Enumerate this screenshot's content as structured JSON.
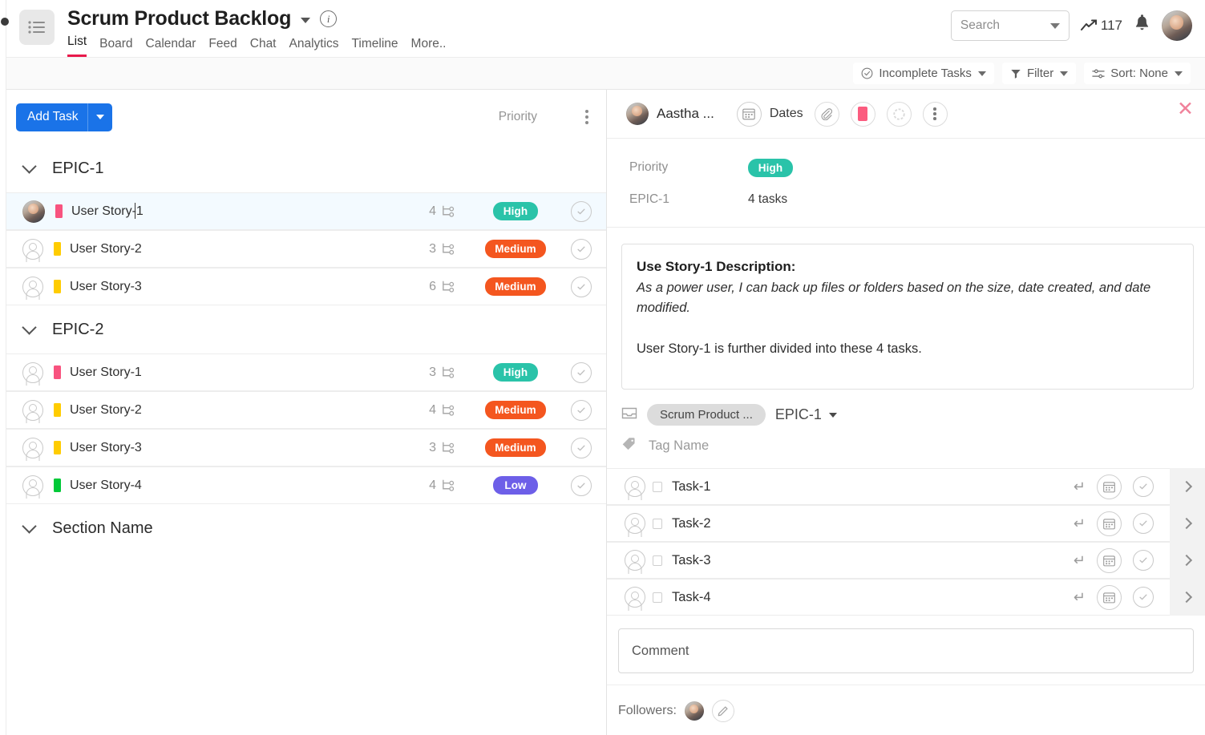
{
  "header": {
    "menu_icon": "hamburger-menu-icon",
    "project_title": "Scrum Product Backlog",
    "project_caret_icon": "chevron-down-icon",
    "info_icon": "info-icon",
    "info_glyph": "i",
    "tabs": [
      {
        "label": "List",
        "active": true
      },
      {
        "label": "Board",
        "active": false
      },
      {
        "label": "Calendar",
        "active": false
      },
      {
        "label": "Feed",
        "active": false
      },
      {
        "label": "Chat",
        "active": false
      },
      {
        "label": "Analytics",
        "active": false
      },
      {
        "label": "Timeline",
        "active": false
      },
      {
        "label": "More..",
        "active": false
      }
    ],
    "search": {
      "placeholder": "Search",
      "value": "",
      "caret_icon": "chevron-down-icon"
    },
    "stat": {
      "icon": "trend-line-icon",
      "count": "117"
    },
    "notification_icon": "bell-icon",
    "avatar": "user-avatar"
  },
  "toolbar": {
    "buttons": [
      {
        "label": "Incomplete Tasks",
        "icon": "check-circle-icon",
        "caret": true
      },
      {
        "label": "Filter",
        "icon": "funnel-icon",
        "caret": true
      },
      {
        "label": "Sort: None",
        "icon": "sliders-icon",
        "caret": true
      }
    ]
  },
  "list_panel": {
    "add_task": {
      "label": "Add Task",
      "caret_icon": "chevron-down-icon"
    },
    "column_priority": "Priority",
    "options_icon": "kebab-menu-icon",
    "groups": [
      {
        "name": "EPIC-1",
        "chevron_icon": "chevron-down-icon",
        "tasks": [
          {
            "name": "User Story-1",
            "color": "#f8537f",
            "subtasks": "4",
            "priority": "High",
            "priority_color": "#2ac3a9",
            "selected": true
          },
          {
            "name": "User Story-2",
            "color": "#ffcc00",
            "subtasks": "3",
            "priority": "Medium",
            "priority_color": "#f4561f",
            "selected": false
          },
          {
            "name": "User Story-3",
            "color": "#ffcc00",
            "subtasks": "6",
            "priority": "Medium",
            "priority_color": "#f4561f",
            "selected": false
          }
        ]
      },
      {
        "name": "EPIC-2",
        "chevron_icon": "chevron-down-icon",
        "tasks": [
          {
            "name": "User Story-1",
            "color": "#f8537f",
            "subtasks": "3",
            "priority": "High",
            "priority_color": "#2ac3a9",
            "selected": false
          },
          {
            "name": "User Story-2",
            "color": "#ffcc00",
            "subtasks": "4",
            "priority": "Medium",
            "priority_color": "#f4561f",
            "selected": false
          },
          {
            "name": "User Story-3",
            "color": "#ffcc00",
            "subtasks": "3",
            "priority": "Medium",
            "priority_color": "#f4561f",
            "selected": false
          },
          {
            "name": "User Story-4",
            "color": "#00c938",
            "subtasks": "4",
            "priority": "Low",
            "priority_color": "#6d5fe8",
            "selected": false
          }
        ]
      },
      {
        "name": "Section Name",
        "chevron_icon": "chevron-down-icon",
        "tasks": []
      }
    ]
  },
  "detail_panel": {
    "assignee_name": "Aastha ...",
    "assignee_avatar": "user-avatar",
    "dates_label": "Dates",
    "dates_icon": "calendar-icon",
    "actions": [
      {
        "name": "attachment-icon"
      },
      {
        "name": "color-swatch-icon",
        "color": "#fb5c7f"
      },
      {
        "name": "circle-progress-icon"
      },
      {
        "name": "kebab-menu-icon"
      }
    ],
    "close_icon": "close-icon",
    "close_glyph": "✕",
    "meta": {
      "priority_label": "Priority",
      "priority_value": "High",
      "priority_color": "#2ac3a9",
      "epic_label": "EPIC-1",
      "epic_value": "4 tasks"
    },
    "description": {
      "title": "Use Story-1 Description:",
      "body_italic": "As a power user, I can back up files or folders based on the size, date created, and date modified.",
      "body_plain": "User Story-1 is further divided into these 4 tasks."
    },
    "project_chip": {
      "icon": "inbox-icon",
      "label": "Scrum Product ..."
    },
    "epic_dropdown": {
      "label": "EPIC-1",
      "caret_icon": "chevron-down-icon"
    },
    "tag": {
      "icon": "tag-icon",
      "placeholder": "Tag Name"
    },
    "subtasks": [
      {
        "name": "Task-1",
        "avatar_icon": "user-placeholder-icon",
        "checkbox_icon": "square-checkbox-icon",
        "enter_icon": "enter-arrow-icon",
        "calendar_icon": "calendar-icon",
        "complete_icon": "check-circle-icon",
        "expand_icon": "chevron-right-icon"
      },
      {
        "name": "Task-2",
        "avatar_icon": "user-placeholder-icon",
        "checkbox_icon": "square-checkbox-icon",
        "enter_icon": "enter-arrow-icon",
        "calendar_icon": "calendar-icon",
        "complete_icon": "check-circle-icon",
        "expand_icon": "chevron-right-icon"
      },
      {
        "name": "Task-3",
        "avatar_icon": "user-placeholder-icon",
        "checkbox_icon": "square-checkbox-icon",
        "enter_icon": "enter-arrow-icon",
        "calendar_icon": "calendar-icon",
        "complete_icon": "check-circle-icon",
        "expand_icon": "chevron-right-icon"
      },
      {
        "name": "Task-4",
        "avatar_icon": "user-placeholder-icon",
        "checkbox_icon": "square-checkbox-icon",
        "enter_icon": "enter-arrow-icon",
        "calendar_icon": "calendar-icon",
        "complete_icon": "check-circle-icon",
        "expand_icon": "chevron-right-icon"
      }
    ],
    "comment": {
      "placeholder": "Comment",
      "value": ""
    },
    "followers": {
      "label": "Followers:",
      "avatar": "user-avatar",
      "edit_icon": "pencil-icon"
    }
  },
  "colors": {
    "accent_blue": "#1a73e8",
    "tab_underline": "#e8194b",
    "priority_high": "#2ac3a9",
    "priority_medium": "#f4561f",
    "priority_low": "#6d5fe8"
  }
}
